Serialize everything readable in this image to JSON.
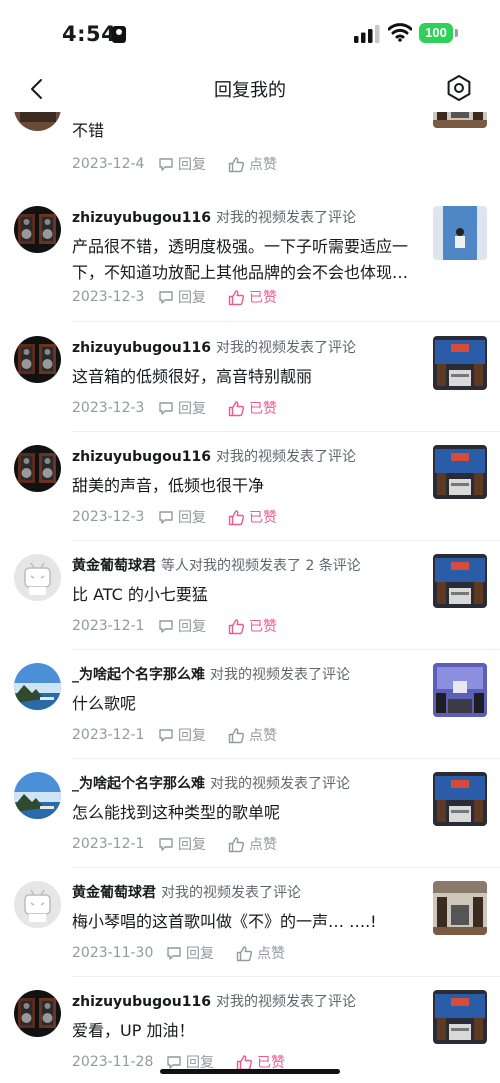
{
  "status_bar": {
    "time": "4:54",
    "battery": "100"
  },
  "header": {
    "title": "回复我的"
  },
  "labels": {
    "reply": "回复",
    "like": "点赞",
    "liked": "已赞"
  },
  "colors": {
    "accent_pink": "#ec5b8c",
    "meta_gray": "#9499a0",
    "battery_green": "#30d158"
  },
  "items": [
    {
      "user": "",
      "action": "",
      "comment": "不错",
      "date": "2023-12-4",
      "liked": false
    },
    {
      "user": "zhizuyubugou116",
      "action": "对我的视频发表了评论",
      "comment": "产品很不错，透明度极强。一下子听需要适应一下，不知道功放配上其他品牌的会不会也体现…",
      "date": "2023-12-3",
      "liked": true
    },
    {
      "user": "zhizuyubugou116",
      "action": "对我的视频发表了评论",
      "comment": "这音箱的低频很好，高音特别靓丽",
      "date": "2023-12-3",
      "liked": true
    },
    {
      "user": "zhizuyubugou116",
      "action": "对我的视频发表了评论",
      "comment": "甜美的声音，低频也很干净",
      "date": "2023-12-3",
      "liked": true
    },
    {
      "user": "黄金葡萄球君",
      "action": "等人对我的视频发表了 2 条评论",
      "comment": "比 ATC 的小七要猛",
      "date": "2023-12-1",
      "liked": true
    },
    {
      "user": "_为啥起个名字那么难",
      "action": "对我的视频发表了评论",
      "comment": "什么歌呢",
      "date": "2023-12-1",
      "liked": false
    },
    {
      "user": "_为啥起个名字那么难",
      "action": "对我的视频发表了评论",
      "comment": "怎么能找到这种类型的歌单呢",
      "date": "2023-12-1",
      "liked": false
    },
    {
      "user": "黄金葡萄球君",
      "action": "对我的视频发表了评论",
      "comment": "梅小琴唱的这首歌叫做《不》的一声…  ….!",
      "date": "2023-11-30",
      "liked": false
    },
    {
      "user": "zhizuyubugou116",
      "action": "对我的视频发表了评论",
      "comment": "爱看，UP 加油！",
      "date": "2023-11-28",
      "liked": true
    }
  ]
}
